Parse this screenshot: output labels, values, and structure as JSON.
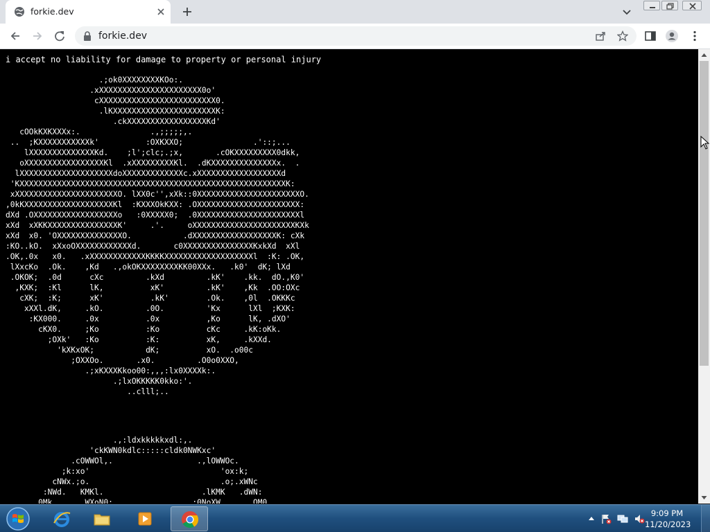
{
  "browser": {
    "tab": {
      "title": "forkie.dev"
    },
    "address_bar": {
      "url": "forkie.dev"
    }
  },
  "page": {
    "disclaimer": "i accept no liability for damage to property or personal injury",
    "ascii_art_top": [
      "                    .;ok0XXXXXXXXKOo:.",
      "                  .xXXXXXXXXXXXXXXXXXXXXXX0o'",
      "                   cXXXXXXXXXXXXXXXXXXXXXXXXX0.",
      "                    .lKXXXXXXXXXXXXXXXXXXXXXXK:",
      "                       .ckXXXXXXXXXXXXXXXXXKd'",
      "   cOOkKXKXXXx:.               .,;;;;;,.",
      " ..  ;KXXXXXXXXXXXk'          :OXKXXO;               .'::;...",
      "    lXXXXXXXXXXXXXXKd.    ;l';clc;.;x,       .cOKXXXXXXXXX0dkk,",
      "   oXXXXXXXXXXXXXXXXXKl  .xXXXXXXXXXKl.  .dKXXXXXXXXXXXXXXx.  .",
      "  lXXXXXXXXXXXXXXXXXXXXdoXXXXXXXXXXXXXc.xXXXXXXXXXXXXXXXXXXd",
      " 'KXXXXXXXXXXXXXXXXXXXXXXXXXXXXXXXXXXXXXXXXXXXXXXXXXXXXXXXXXK:",
      " xXXXXXXXXXXXXXXXXXXXXXXO. lXX0c'',xXk::0XXXXXXXXXXXXXXXXXXXXXXO.",
      ",0kKXXXXXXXXXXXXXXXXXXXKl  :KXXXOkKXX: .OXXXXXXXXXXXXXXXXXXXXXX:",
      "dXd .OXXXXXXXXXXXXXXXXXXo   :0XXXXX0;  .0XXXXXXXXXXXXXXXXXXXXXXl",
      "xXd  xXKKXXXXXXXXXXXXXXXK'     .'.     oXXXXXXXXXXXXXXXXXXXXXXKXk",
      "xXd  x0. 'OXXXXXXXXXXXXXXO.           .dXXXXXXXXXXXXXXXXXXK: cXk",
      ":KO..kO.  xXxoOXXXXXXXXXXXXd.       c0XXXXXXXXXXXXXXXKxkXd  xXl",
      ".OK,.0x   x0.   .xXXXXXXXXXXXXKKKKXXXXXXXXXXXXXXXXXXXl  :K: .OK,",
      " lXxcKo  .Ok.    ,Kd   .,okOKXXXXXXXXKK00XXx.   .k0'  dK; lXd",
      " .OKOK;  .0d      cXc         .kXd         .kK'    .kk.  dO.,K0'",
      "  ,KXK;  :Kl      lK,          xK'         .kK'    ,Kk  .OO:OXc",
      "   cXK;  :K;      xK'          .kK'        .Ok.    ,0l  .OKKKc",
      "    xXXl.dK,     .kO.         .0O.         'Kx      lXl  ;KXK:",
      "     :KX000.     .0x          .0x          ,Ko      lK, .dXO'",
      "       cKX0.     ;Ko          :Ko          cKc     .kK:oKk.",
      "         ;OXk'   :Ko          :K:          xK,     .kXXd.",
      "           'kXKxOK;           dK;          xO.  .o00c",
      "              ;OXXOo.       .x0.         .O0o0XXO,",
      "                 .;xKXXXKkoo00:,,,:lx0XXXXk:.",
      "                       .;lxOKKKKK0kko:'.",
      "                          ..clll;.."
    ],
    "ascii_art_bottom": [
      "                       .,:ldxkkkkkxdl:,.",
      "                  'ckKWN0kdlc:::::cldk0NWKxc'",
      "              .cOWWOl,.                  .,lOWWOc.",
      "            ;k:xo'                            'ox:k;",
      "          cNWx.;o.                            .o;.xWNc",
      "        :NWd.   KMKl.                     .lKMK   .dWN:",
      "       0Mk       WXoN0:                 :0NoXW       OM0"
    ]
  },
  "taskbar": {
    "clock": {
      "time": "9:09 PM",
      "date": "11/20/2023"
    }
  },
  "theme": {
    "tabstrip_bg": "#dee1e6",
    "page_bg": "#000000",
    "page_text": "#ffffff",
    "taskbar_bg": "#1f4f7e"
  }
}
